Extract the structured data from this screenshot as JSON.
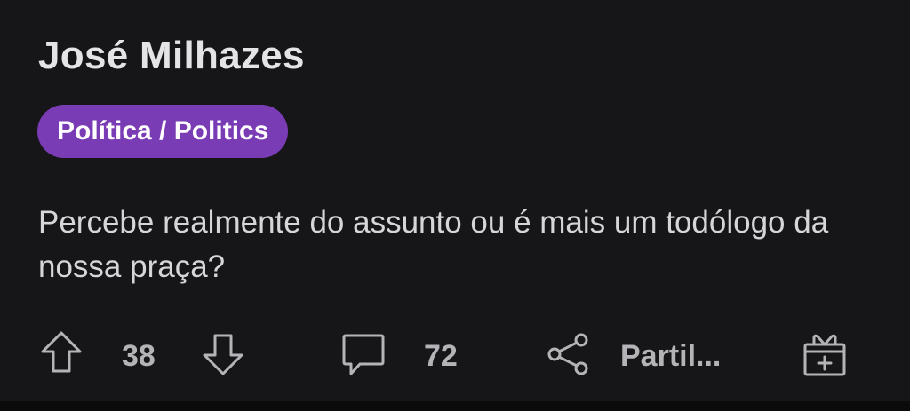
{
  "post": {
    "author": "José Milhazes",
    "flair": "Política / Politics",
    "body": "Percebe realmente do assunto ou é mais um todólogo da nossa praça?",
    "upvotes": "38",
    "comments": "72",
    "share_label": "Partil..."
  },
  "colors": {
    "background": "#161517",
    "flair": "#7a3cb5",
    "text": "#e4e3e6",
    "muted": "#b4b3b8"
  },
  "icons": [
    "upvote-arrow-icon",
    "downvote-arrow-icon",
    "comment-bubble-icon",
    "share-icon",
    "award-gift-icon"
  ]
}
